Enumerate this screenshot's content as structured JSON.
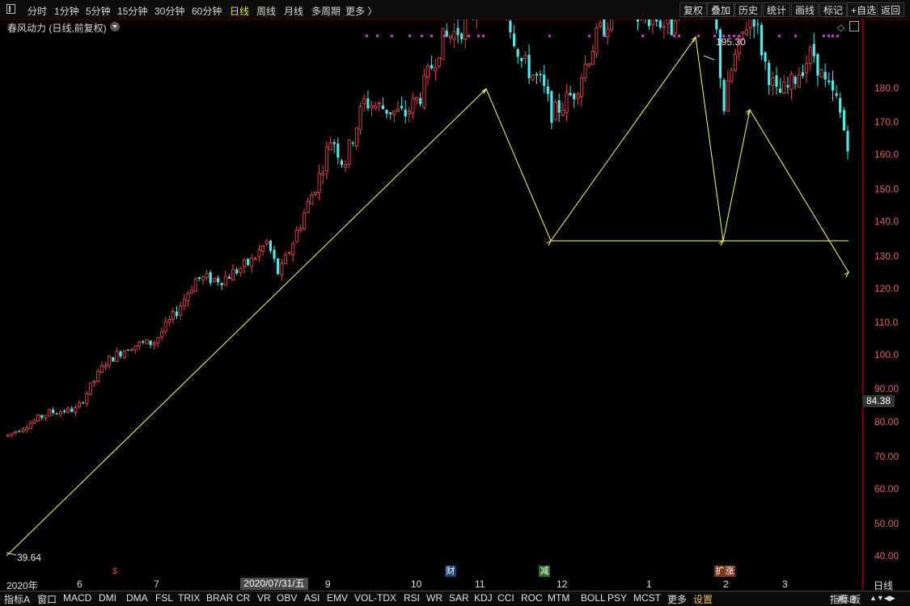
{
  "toolbar": {
    "left_items": [
      "分时",
      "1分钟",
      "5分钟",
      "15分钟",
      "30分钟",
      "60分钟",
      "日线",
      "周线",
      "月线",
      "多周期",
      "更多 〉"
    ],
    "active": "日线",
    "right_items": [
      "复权",
      "叠加",
      "历史",
      "统计",
      "画线",
      "标记",
      "+自选",
      "返回"
    ]
  },
  "chart_title": "春风动力 (日线,前复权)",
  "price_box": "84.38",
  "annotations": {
    "high": "195.30",
    "low": "39.64"
  },
  "y_labels": [
    "180.0",
    "170.0",
    "160.0",
    "150.0",
    "140.0",
    "130.0",
    "120.0",
    "110.0",
    "100.0",
    "90.00",
    "80.00",
    "70.00",
    "60.00",
    "50.00",
    "40.00"
  ],
  "x_labels": [
    "2020年",
    "6",
    "7",
    "9",
    "10",
    "11",
    "12",
    "1",
    "2",
    "3"
  ],
  "x_highlight": "2020/07/31/五",
  "period_tab": "日线",
  "markers": [
    "$",
    "财",
    "减",
    "扩",
    "涨"
  ],
  "bottom_items": [
    "指标A",
    "窗口",
    "MACD",
    "DMI",
    "DMA",
    "FSL",
    "TRIX",
    "BRAR",
    "CR",
    "VR",
    "OBV",
    "ASI",
    "EMV",
    "VOL-TDX",
    "RSI",
    "WR",
    "SAR",
    "KDJ",
    "CCI",
    "ROC",
    "MTM",
    "BOLL",
    "PSY",
    "MCST",
    "更多",
    "设置"
  ],
  "bottom_right": [
    "指标B",
    "模",
    "板"
  ],
  "colors": {
    "up": "#e04646",
    "down": "#54e6e6",
    "line": "#ffff66",
    "dots": "#d42ad4",
    "axis": "#e06060"
  },
  "chart_data": {
    "type": "candlestick",
    "ylim": [
      36,
      200
    ],
    "x_range": [
      "2020-04-28",
      "2021-04-16"
    ],
    "ohlc": []
  }
}
